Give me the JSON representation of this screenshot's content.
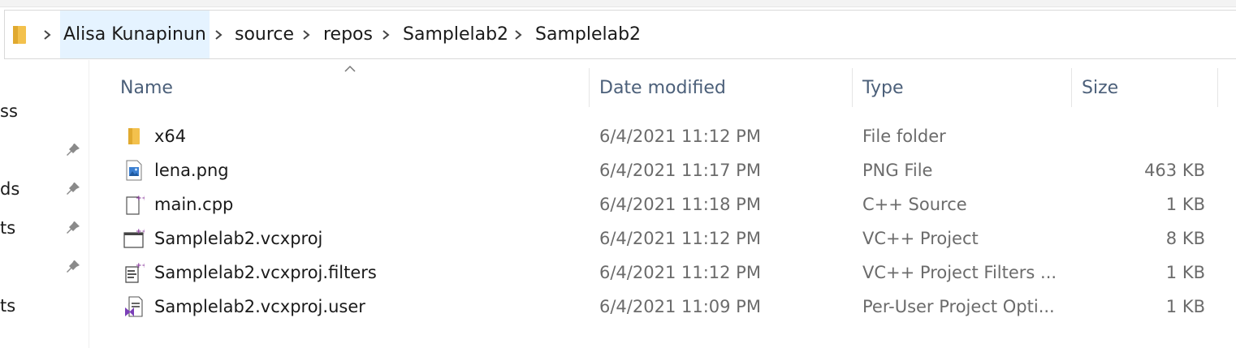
{
  "breadcrumb": [
    "Alisa Kunapinun",
    "source",
    "repos",
    "Samplelab2",
    "Samplelab2"
  ],
  "nav": [
    "ss",
    "ds",
    "ts",
    "ts"
  ],
  "columns": {
    "name": "Name",
    "date": "Date modified",
    "type": "Type",
    "size": "Size"
  },
  "files": [
    {
      "name": "x64",
      "date": "6/4/2021 11:12 PM",
      "type": "File folder",
      "size": "",
      "icon": "folder-icon"
    },
    {
      "name": "lena.png",
      "date": "6/4/2021 11:17 PM",
      "type": "PNG File",
      "size": "463 KB",
      "icon": "image-file-icon"
    },
    {
      "name": "main.cpp",
      "date": "6/4/2021 11:18 PM",
      "type": "C++ Source",
      "size": "1 KB",
      "icon": "cpp-file-icon"
    },
    {
      "name": "Samplelab2.vcxproj",
      "date": "6/4/2021 11:12 PM",
      "type": "VC++ Project",
      "size": "8 KB",
      "icon": "vcxproj-file-icon"
    },
    {
      "name": "Samplelab2.vcxproj.filters",
      "date": "6/4/2021 11:12 PM",
      "type": "VC++ Project Filters ...",
      "size": "1 KB",
      "icon": "filters-file-icon"
    },
    {
      "name": "Samplelab2.vcxproj.user",
      "date": "6/4/2021 11:09 PM",
      "type": "Per-User Project Opti...",
      "size": "1 KB",
      "icon": "vs-user-file-icon"
    }
  ]
}
